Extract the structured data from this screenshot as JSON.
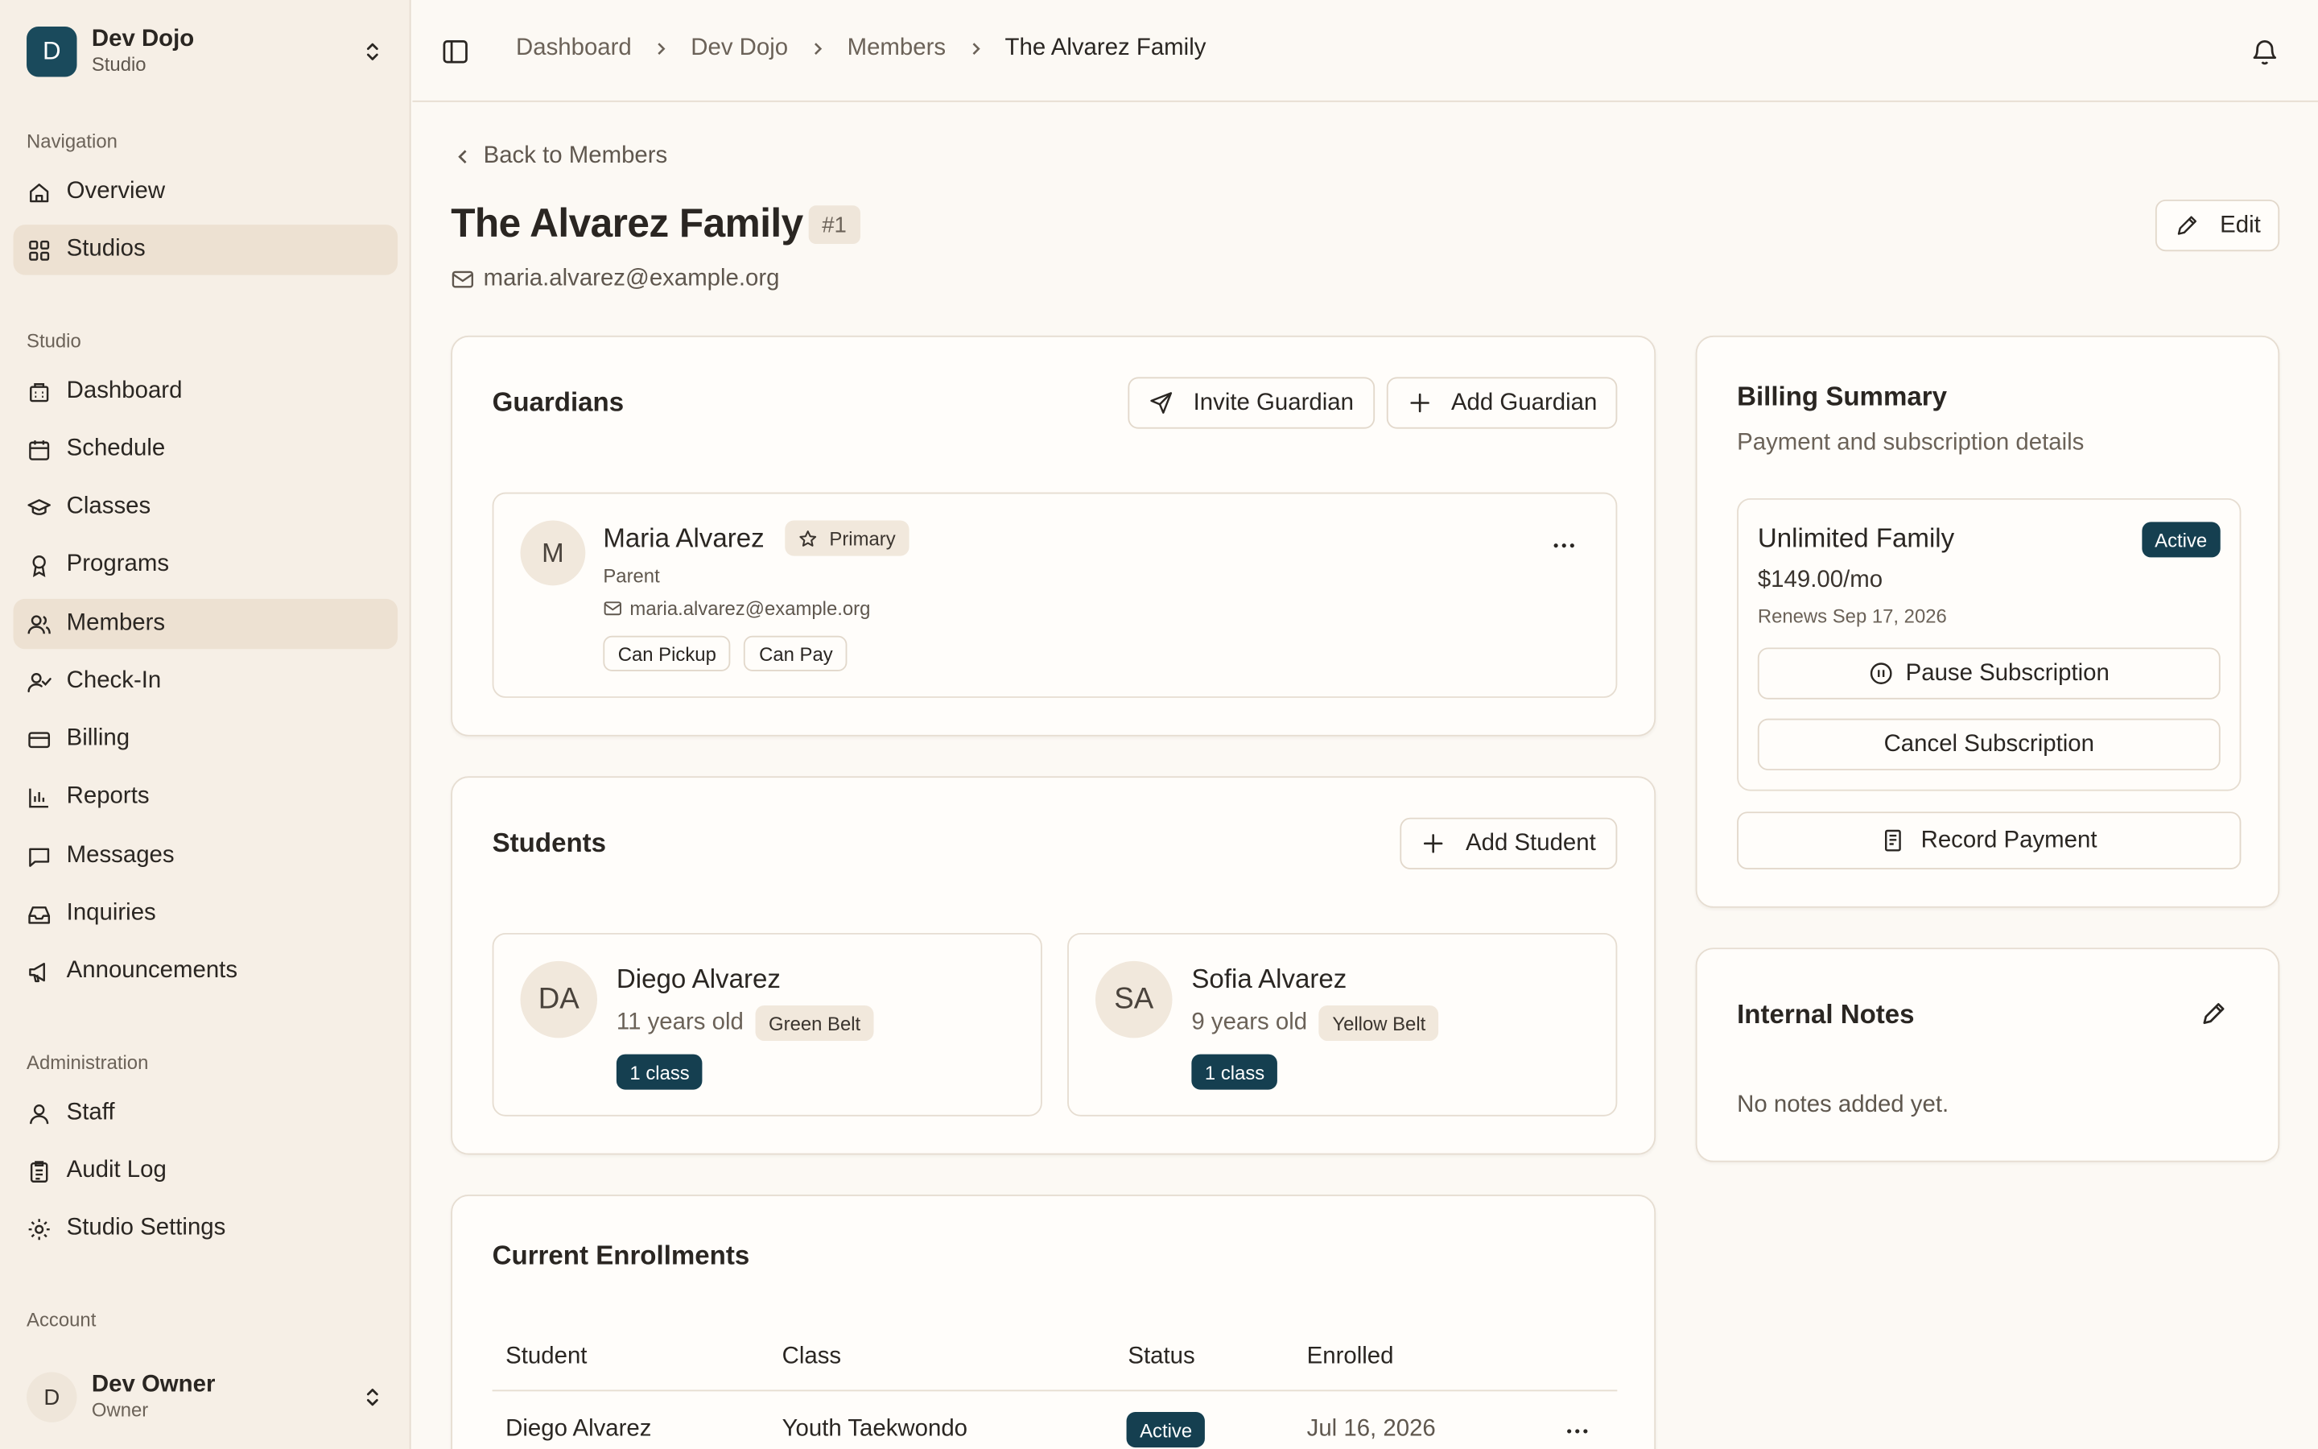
{
  "studio": {
    "initial": "D",
    "name": "Dev Dojo",
    "role": "Studio"
  },
  "nav": {
    "section_navigation": "Navigation",
    "overview": "Overview",
    "studios": "Studios",
    "section_studio": "Studio",
    "dashboard": "Dashboard",
    "schedule": "Schedule",
    "classes": "Classes",
    "programs": "Programs",
    "members": "Members",
    "checkin": "Check-In",
    "billing": "Billing",
    "reports": "Reports",
    "messages": "Messages",
    "inquiries": "Inquiries",
    "announcements": "Announcements",
    "section_admin": "Administration",
    "staff": "Staff",
    "audit_log": "Audit Log",
    "studio_settings": "Studio Settings",
    "section_account": "Account"
  },
  "account": {
    "initial": "D",
    "name": "Dev Owner",
    "role": "Owner"
  },
  "breadcrumb": [
    "Dashboard",
    "Dev Dojo",
    "Members",
    "The Alvarez Family"
  ],
  "page": {
    "back_label": "Back to Members",
    "title": "The Alvarez Family",
    "id_label": "#1",
    "email": "maria.alvarez@example.org",
    "edit_label": "Edit"
  },
  "guardians": {
    "title": "Guardians",
    "invite_label": "Invite Guardian",
    "add_label": "Add Guardian",
    "items": [
      {
        "initial": "M",
        "name": "Maria Alvarez",
        "badge": "Primary",
        "relation": "Parent",
        "email": "maria.alvarez@example.org",
        "permissions": [
          "Can Pickup",
          "Can Pay"
        ]
      }
    ]
  },
  "students": {
    "title": "Students",
    "add_label": "Add Student",
    "items": [
      {
        "initials": "DA",
        "name": "Diego Alvarez",
        "age": "11 years old",
        "belt": "Green Belt",
        "classes": "1 class"
      },
      {
        "initials": "SA",
        "name": "Sofia Alvarez",
        "age": "9 years old",
        "belt": "Yellow Belt",
        "classes": "1 class"
      }
    ]
  },
  "enrollments": {
    "title": "Current Enrollments",
    "columns": [
      "Student",
      "Class",
      "Status",
      "Enrolled"
    ],
    "rows": [
      {
        "student": "Diego Alvarez",
        "class": "Youth Taekwondo",
        "status": "Active",
        "enrolled": "Jul 16, 2026"
      }
    ]
  },
  "billing": {
    "title": "Billing Summary",
    "subtitle": "Payment and subscription details",
    "plan_name": "Unlimited Family",
    "plan_status": "Active",
    "price": "$149.00/mo",
    "renews": "Renews Sep 17, 2026",
    "pause_label": "Pause Subscription",
    "cancel_label": "Cancel Subscription",
    "record_label": "Record Payment"
  },
  "notes": {
    "title": "Internal Notes",
    "empty": "No notes added yet."
  },
  "colors": {
    "brand": "#1a4a5c",
    "badge_dark": "#153f50",
    "sidebar_bg": "#f6efe6",
    "page_bg": "#fcf9f4",
    "active_nav": "#ede1d2"
  }
}
